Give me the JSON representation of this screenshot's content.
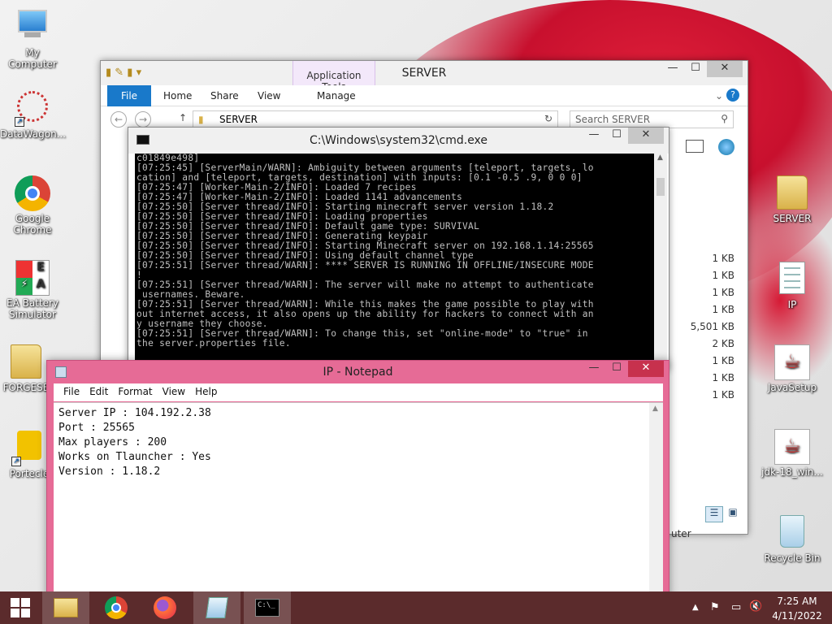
{
  "desktop": {
    "left_icons": [
      {
        "label": "My Computer"
      },
      {
        "label": "DataWagon..."
      },
      {
        "label": "Google Chrome"
      },
      {
        "label": "EA Battery Simulator"
      },
      {
        "label": "FORGESE"
      },
      {
        "label": "Portecle"
      }
    ],
    "right_icons": [
      {
        "label": "SERVER"
      },
      {
        "label": "IP"
      },
      {
        "label": "JavaSetup"
      },
      {
        "label": "jdk-18_win..."
      },
      {
        "label": "Recycle Bin"
      }
    ]
  },
  "explorer": {
    "title": "SERVER",
    "app_tools": "Application Tools",
    "tabs": [
      "File",
      "Home",
      "Share",
      "View",
      "Manage"
    ],
    "breadcrumb": "SERVER",
    "search_placeholder": "Search SERVER",
    "sizes": [
      "1 KB",
      "1 KB",
      "1 KB",
      "1 KB",
      "5,501 KB",
      "2 KB",
      "1 KB",
      "1 KB",
      "1 KB"
    ],
    "status_fragment": "uter"
  },
  "cmd": {
    "title": "C:\\Windows\\system32\\cmd.exe",
    "lines": [
      "c01849e498]",
      "[07:25:45] [ServerMain/WARN]: Ambiguity between arguments [teleport, targets, lo",
      "cation] and [teleport, targets, destination] with inputs: [0.1 -0.5 .9, 0 0 0]",
      "[07:25:47] [Worker-Main-2/INFO]: Loaded 7 recipes",
      "[07:25:47] [Worker-Main-2/INFO]: Loaded 1141 advancements",
      "[07:25:50] [Server thread/INFO]: Starting minecraft server version 1.18.2",
      "[07:25:50] [Server thread/INFO]: Loading properties",
      "[07:25:50] [Server thread/INFO]: Default game type: SURVIVAL",
      "[07:25:50] [Server thread/INFO]: Generating keypair",
      "[07:25:50] [Server thread/INFO]: Starting Minecraft server on 192.168.1.14:25565",
      "",
      "[07:25:50] [Server thread/INFO]: Using default channel type",
      "[07:25:51] [Server thread/WARN]: **** SERVER IS RUNNING IN OFFLINE/INSECURE MODE",
      "!",
      "[07:25:51] [Server thread/WARN]: The server will make no attempt to authenticate",
      " usernames. Beware.",
      "[07:25:51] [Server thread/WARN]: While this makes the game possible to play with",
      "out internet access, it also opens up the ability for hackers to connect with an",
      "y username they choose.",
      "[07:25:51] [Server thread/WARN]: To change this, set \"online-mode\" to \"true\" in",
      "the server.properties file."
    ]
  },
  "notepad": {
    "title": "IP - Notepad",
    "menu": [
      "File",
      "Edit",
      "Format",
      "View",
      "Help"
    ],
    "lines": [
      "Server IP : 104.192.2.38",
      "Port : 25565",
      "Max players : 200",
      "Works on Tlauncher : Yes",
      "Version : 1.18.2"
    ]
  },
  "taskbar": {
    "time": "7:25 AM",
    "date": "4/11/2022"
  },
  "colors": {
    "notepad_frame": "#e66b96",
    "explorer_file_tab": "#1979ca",
    "taskbar": "#5b2b2c",
    "close_button": "#c7c7c7"
  },
  "icons": [
    "computer-icon",
    "datawagon-icon",
    "chrome-icon",
    "battery-icon",
    "folder-icon",
    "portecle-icon",
    "java-icon",
    "recycle-bin-icon",
    "windows-start-icon",
    "file-explorer-icon",
    "firefox-icon",
    "notepad-icon",
    "cmd-icon"
  ]
}
